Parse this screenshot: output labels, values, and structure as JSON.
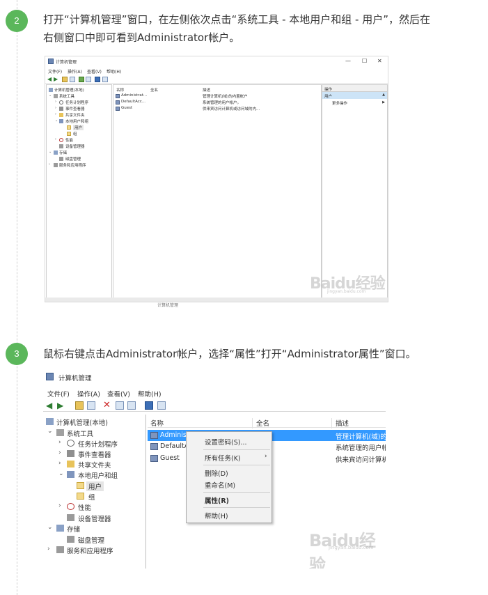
{
  "steps": [
    {
      "number": "2",
      "text_line1": "打开“计算机管理”窗口，在左侧依次点击“系统工具 - 本地用户和组 - 用户”，然后在",
      "text_line2": "右侧窗口中即可看到Administrator帐户。"
    },
    {
      "number": "3",
      "text": "鼠标右键点击Administrator帐户，选择“属性”打开“Administrator属性”窗口。"
    }
  ],
  "colors": {
    "badge": "#5bb75b",
    "selection": "#3399ff",
    "action_selected": "#cde4f7"
  },
  "window": {
    "title": "计算机管理",
    "controls": {
      "minimize": "—",
      "maximize": "☐",
      "close": "✕"
    },
    "menu": [
      "文件(F)",
      "操作(A)",
      "查看(V)",
      "帮助(H)"
    ]
  },
  "tree": {
    "root": "计算机管理(本地)",
    "system_tools": "系统工具",
    "task_scheduler": "任务计划程序",
    "event_viewer": "事件查看器",
    "shared_folders": "共享文件夹",
    "local_users_groups": "本地用户和组",
    "users": "用户",
    "groups": "组",
    "performance": "性能",
    "device_manager": "设备管理器",
    "storage": "存储",
    "disk_management": "磁盘管理",
    "services_apps": "服务和应用程序"
  },
  "list": {
    "columns": [
      "名称",
      "全名",
      "描述"
    ],
    "shot1_rows": [
      {
        "name": "Administrat...",
        "desc": "管理计算机(域)的内置帐户"
      },
      {
        "name": "DefaultAcc...",
        "desc": "系统管理的用户帐户。"
      },
      {
        "name": "Guest",
        "desc": "供来宾访问计算机或访问域的内..."
      }
    ],
    "shot2_rows": [
      {
        "name": "Administr",
        "desc": "管理计算机(域)的"
      },
      {
        "name": "DefaultA",
        "desc": "系统管理的用户帐"
      },
      {
        "name": "Guest",
        "desc": "供来宾访问计算机"
      }
    ]
  },
  "actions": {
    "header": "操作",
    "selected": "用户",
    "more": "更多操作"
  },
  "context_menu": {
    "set_password": "设置密码(S)...",
    "all_tasks": "所有任务(K)",
    "delete": "删除(D)",
    "rename": "重命名(M)",
    "properties": "属性(R)",
    "help": "帮助(H)"
  },
  "watermark": {
    "brand": "Baidu经验",
    "url": "jingyan.baidu.com"
  },
  "ghost_caption": "计算机管理"
}
